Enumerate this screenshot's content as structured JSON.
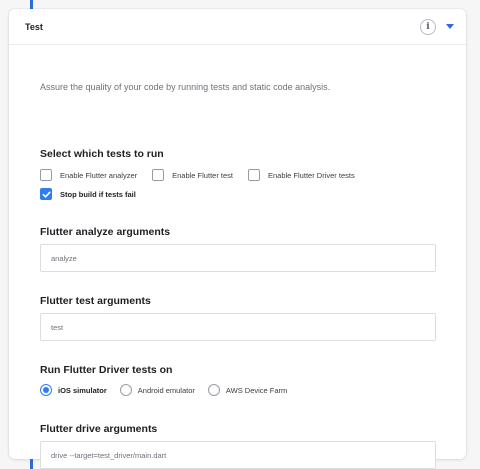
{
  "card": {
    "title": "Test",
    "info_icon": "info-icon",
    "collapse_icon": "caret-down-icon"
  },
  "description": "Assure the quality of your code by running tests and static code analysis.",
  "tests_section": {
    "heading": "Select which tests to run",
    "options": [
      {
        "label": "Enable Flutter analyzer",
        "checked": false
      },
      {
        "label": "Enable Flutter test",
        "checked": false
      },
      {
        "label": "Enable Flutter Driver tests",
        "checked": false
      }
    ],
    "stop_build": {
      "label": "Stop build if tests fail",
      "checked": true
    }
  },
  "analyze_args": {
    "heading": "Flutter analyze arguments",
    "value": "analyze"
  },
  "test_args": {
    "heading": "Flutter test arguments",
    "value": "test"
  },
  "driver_target": {
    "heading": "Run Flutter Driver tests on",
    "options": [
      {
        "label": "iOS simulator",
        "selected": true
      },
      {
        "label": "Android emulator",
        "selected": false
      },
      {
        "label": "AWS Device Farm",
        "selected": false
      }
    ]
  },
  "drive_args": {
    "heading": "Flutter drive arguments",
    "value": "drive --target=test_driver/main.dart"
  },
  "colors": {
    "accent": "#2f7df3",
    "timeline": "#2f6bd8"
  }
}
